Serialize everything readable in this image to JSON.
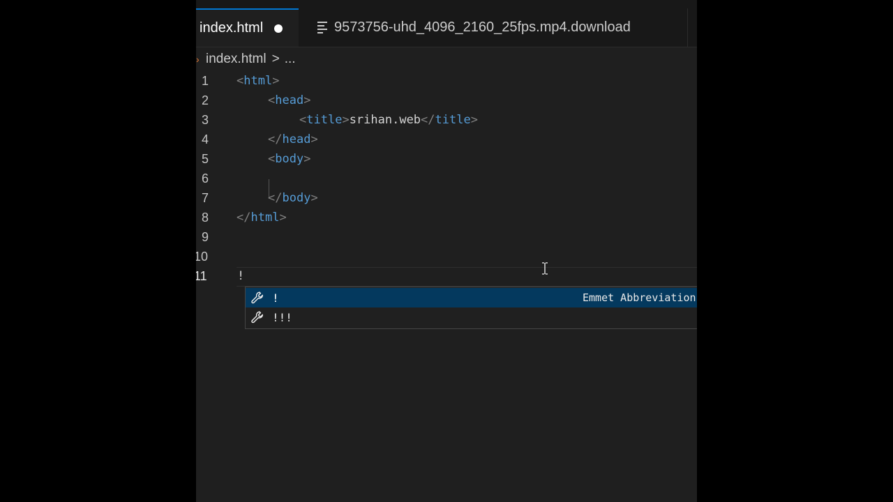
{
  "tabs": [
    {
      "label": "index.html",
      "active": true,
      "dirty": true,
      "icon": "none"
    },
    {
      "label": "9573756-uhd_4096_2160_25fps.mp4.download",
      "active": false,
      "dirty": false,
      "icon": "file-lines-icon"
    }
  ],
  "breadcrumb": {
    "file": "index.html",
    "separator": ">",
    "more": "..."
  },
  "code_lines": [
    {
      "number": "1"
    },
    {
      "number": "2"
    },
    {
      "number": "3"
    },
    {
      "number": "4"
    },
    {
      "number": "5"
    },
    {
      "number": "6"
    },
    {
      "number": "7"
    },
    {
      "number": "8"
    },
    {
      "number": "9"
    },
    {
      "number": "10"
    },
    {
      "number": "11"
    }
  ],
  "code": {
    "lt": "<",
    "gt": ">",
    "lt_slash": "</",
    "html": "html",
    "head": "head",
    "title": "title",
    "title_text": "srihan.web",
    "body": "body",
    "typed": "!"
  },
  "suggestions": [
    {
      "label": "!",
      "detail": "Emmet Abbreviation",
      "selected": true,
      "icon": "wrench-icon"
    },
    {
      "label": "!!!",
      "detail": "",
      "selected": false,
      "icon": "wrench-icon"
    }
  ],
  "colors": {
    "accent": "#0078d4",
    "tag": "#569cd6",
    "bracket": "#808080",
    "selection": "#04395e",
    "editor_bg": "#1f1f1f"
  }
}
